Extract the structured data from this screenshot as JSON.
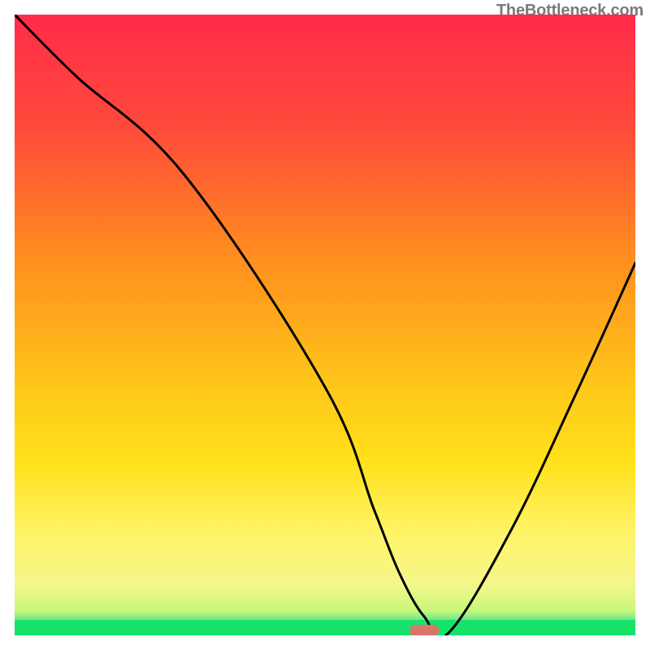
{
  "watermark": "TheBottleneck.com",
  "chart_data": {
    "type": "line",
    "title": "",
    "xlabel": "",
    "ylabel": "",
    "xlim": [
      0,
      100
    ],
    "ylim": [
      0,
      100
    ],
    "grid": false,
    "legend": null,
    "gradient_colors": {
      "top": "#ff2b4a",
      "upper_mid": "#ff8a1f",
      "mid": "#ffd400",
      "lower_mid": "#f7f77a",
      "above_green": "#c8f77a",
      "green": "#17e36b"
    },
    "series": [
      {
        "name": "bottleneck-curve",
        "color": "#000000",
        "x": [
          0,
          10,
          27.5,
          50,
          58,
          62,
          66,
          70,
          80,
          90,
          100
        ],
        "y": [
          100,
          90,
          74,
          40,
          20,
          10,
          3,
          0.5,
          17,
          38,
          60
        ]
      }
    ],
    "marker": {
      "name": "optimal-point",
      "x": 66,
      "y": 0.8,
      "color": "#d9756c",
      "shape": "capsule"
    },
    "green_band": {
      "y_top": 2.5,
      "y_bottom": 0
    }
  }
}
